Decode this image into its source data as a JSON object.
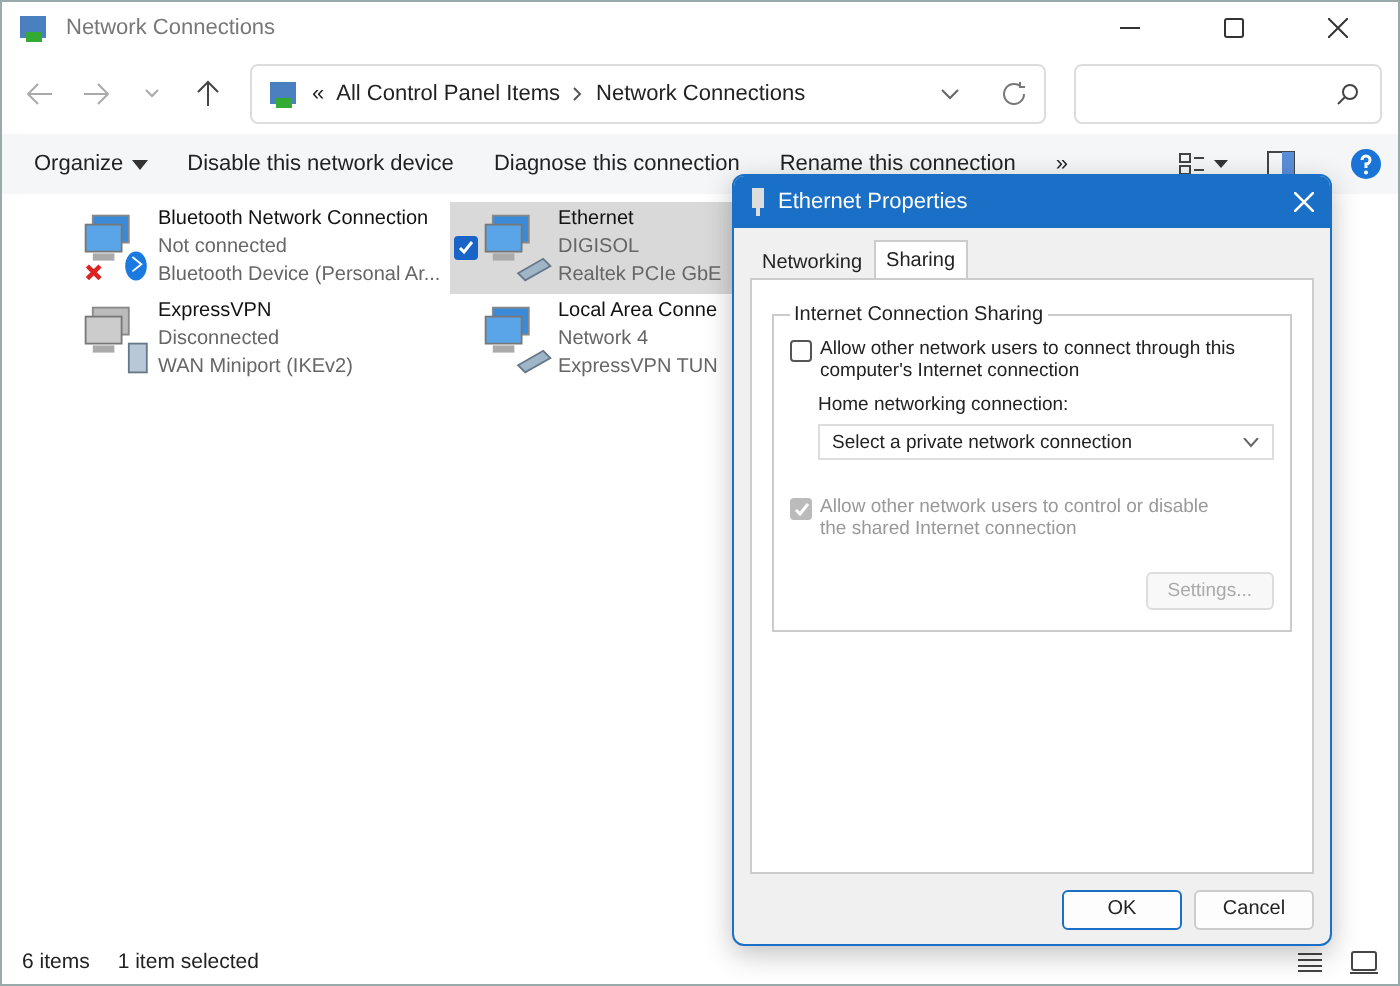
{
  "window": {
    "title": "Network Connections"
  },
  "address_bar": {
    "overflow": "«",
    "segments": [
      "All Control Panel Items",
      "Network Connections"
    ]
  },
  "toolbar": [
    {
      "label": "Organize",
      "dropdown": true
    },
    {
      "label": "Disable this network device",
      "dropdown": false
    },
    {
      "label": "Diagnose this connection",
      "dropdown": false
    },
    {
      "label": "Rename this connection",
      "dropdown": false
    },
    {
      "label": "»",
      "dropdown": false
    }
  ],
  "connections": [
    {
      "name": "Bluetooth Network Connection",
      "status": "Not connected",
      "device": "Bluetooth Device (Personal Ar...",
      "kind": "bluetooth",
      "failed": true,
      "selected": false
    },
    {
      "name": "Ethernet",
      "status": "DIGISOL",
      "device": "Realtek PCIe GbE",
      "kind": "ethernet",
      "failed": false,
      "selected": true
    },
    {
      "name": "ExpressVPN",
      "status": "Disconnected",
      "device": "WAN Miniport (IKEv2)",
      "kind": "wan",
      "failed": false,
      "selected": false
    },
    {
      "name": "Local Area Conne",
      "status": "Network 4",
      "device": "ExpressVPN TUN",
      "kind": "ethernet",
      "failed": false,
      "selected": false
    }
  ],
  "status_bar": {
    "count": "6 items",
    "selection": "1 item selected"
  },
  "dialog": {
    "title": "Ethernet Properties",
    "tabs": [
      {
        "label": "Networking",
        "selected": false
      },
      {
        "label": "Sharing",
        "selected": true
      }
    ],
    "group": "Internet Connection Sharing",
    "allow_connect": {
      "label": "Allow other network users to connect through this computer's Internet connection",
      "checked": false,
      "disabled": false
    },
    "home_label": "Home networking connection:",
    "home_value": "Select a private network connection",
    "allow_control": {
      "label": "Allow other network users to control or disable the shared Internet connection",
      "checked": true,
      "disabled": true
    },
    "settings": {
      "label": "Settings...",
      "disabled": true
    },
    "buttons": [
      {
        "label": "OK",
        "default": true
      },
      {
        "label": "Cancel",
        "default": false
      }
    ]
  }
}
